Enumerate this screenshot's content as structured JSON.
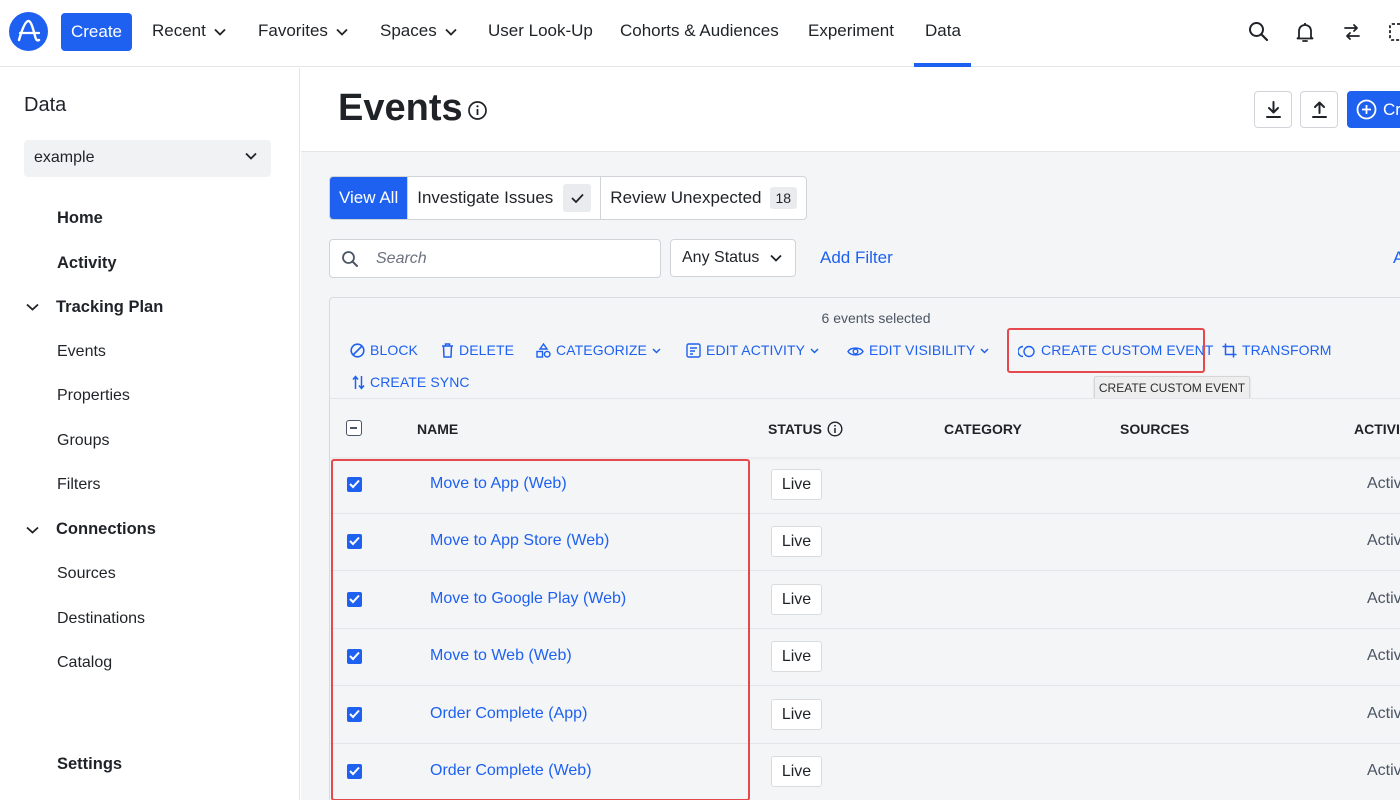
{
  "topnav": {
    "create_label": "Create",
    "items": [
      {
        "label": "Recent",
        "dropdown": true
      },
      {
        "label": "Favorites",
        "dropdown": true
      },
      {
        "label": "Spaces",
        "dropdown": true
      },
      {
        "label": "User Look-Up",
        "dropdown": false
      },
      {
        "label": "Cohorts & Audiences",
        "dropdown": false
      },
      {
        "label": "Experiment",
        "dropdown": false
      },
      {
        "label": "Data",
        "dropdown": false,
        "active": true
      }
    ],
    "icons": [
      "search-icon",
      "bell-icon",
      "switch-icon",
      "apps-icon"
    ]
  },
  "sidebar": {
    "title": "Data",
    "project_select": "example",
    "items": [
      {
        "label": "Home",
        "level": "top"
      },
      {
        "label": "Activity",
        "level": "top"
      },
      {
        "label": "Tracking Plan",
        "level": "section",
        "expanded": true
      },
      {
        "label": "Events",
        "level": "child"
      },
      {
        "label": "Properties",
        "level": "child"
      },
      {
        "label": "Groups",
        "level": "child"
      },
      {
        "label": "Filters",
        "level": "child"
      },
      {
        "label": "Connections",
        "level": "section",
        "expanded": true
      },
      {
        "label": "Sources",
        "level": "child"
      },
      {
        "label": "Destinations",
        "level": "child"
      },
      {
        "label": "Catalog",
        "level": "child"
      },
      {
        "label": "Settings",
        "level": "top"
      }
    ]
  },
  "page": {
    "title": "Events",
    "create_label": "Cr"
  },
  "tabs": [
    {
      "label": "View All",
      "active": true
    },
    {
      "label": "Investigate Issues",
      "badge": "check"
    },
    {
      "label": "Review Unexpected",
      "badge": "18"
    }
  ],
  "filters": {
    "search_placeholder": "Search",
    "status_select": "Any Status",
    "add_filter": "Add Filter",
    "edge_link": "A"
  },
  "bulk": {
    "selected_text": "6 events selected",
    "actions": {
      "block": "BLOCK",
      "delete": "DELETE",
      "categorize": "CATEGORIZE",
      "edit_activity": "EDIT ACTIVITY",
      "edit_visibility": "EDIT VISIBILITY",
      "create_custom_event": "CREATE CUSTOM EVENT",
      "transform": "TRANSFORM",
      "create_sync": "CREATE SYNC"
    },
    "tooltip": "CREATE CUSTOM EVENT"
  },
  "table": {
    "columns": {
      "name": "NAME",
      "status": "STATUS",
      "category": "CATEGORY",
      "sources": "SOURCES",
      "activity": "ACTIVI"
    },
    "rows": [
      {
        "name": "Move to App (Web)",
        "status": "Live",
        "activity": "Activ",
        "checked": true
      },
      {
        "name": "Move to App Store (Web)",
        "status": "Live",
        "activity": "Activ",
        "checked": true
      },
      {
        "name": "Move to Google Play (Web)",
        "status": "Live",
        "activity": "Activ",
        "checked": true
      },
      {
        "name": "Move to Web (Web)",
        "status": "Live",
        "activity": "Activ",
        "checked": true
      },
      {
        "name": "Order Complete (App)",
        "status": "Live",
        "activity": "Activ",
        "checked": true
      },
      {
        "name": "Order Complete (Web)",
        "status": "Live",
        "activity": "Activ",
        "checked": true
      }
    ]
  },
  "colors": {
    "accent": "#1e61f0",
    "highlight": "#e5484d"
  }
}
